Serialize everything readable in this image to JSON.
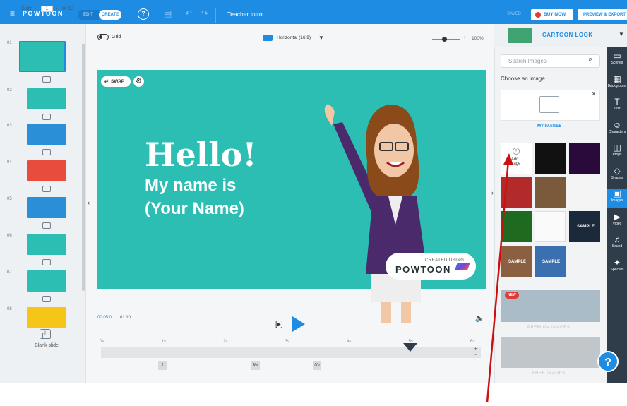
{
  "topbar": {
    "logo": "POWTOON",
    "mode_edit": "EDIT",
    "mode_create": "CREATE",
    "title": "Teacher Intro",
    "saved": "SAVED",
    "buy_now": "BUY NOW",
    "preview_export": "PREVIEW & EXPORT"
  },
  "slides": {
    "label": "Slide",
    "current": "1",
    "of_total": "of 10",
    "numbers": [
      "01",
      "02",
      "03",
      "04",
      "05",
      "06",
      "07",
      "08"
    ],
    "blank_slide": "Blank slide",
    "thumb_colors": [
      "#2cbeb3",
      "#2cbeb3",
      "#2a8fd6",
      "#e74c3c",
      "#2a8fd6",
      "#2cbeb3",
      "#2cbeb3",
      "#f5c518"
    ]
  },
  "canvas": {
    "grid_label": "Grid",
    "orientation": "Horizontal (16:9)",
    "zoom": "100%",
    "swap": "SWAP",
    "hello": "Hello!",
    "my_name_is": "My name is",
    "your_name": "(Your Name)",
    "created_using": "CREATED USING",
    "powtoon": "POWTOON"
  },
  "playback": {
    "current_time": "00:05:0",
    "total_time": "01:10",
    "ticks": [
      "0s",
      "1s",
      "2s",
      "3s",
      "4s",
      "5s",
      "6s"
    ],
    "markers": [
      "2",
      "My",
      "(Yo"
    ]
  },
  "rightpanel": {
    "look": "CARTOON LOOK",
    "search_placeholder": "Search Images",
    "choose_label": "Choose an image",
    "my_images": "MY IMAGES",
    "add_image": "Add\nimage",
    "new_badge": "NEW",
    "premium_images": "PREMIUM IMAGES",
    "free_images": "FREE IMAGES",
    "sample": "SAMPLE"
  },
  "rail": [
    {
      "icon": "scenes-icon",
      "glyph": "▭",
      "label": "Scenes"
    },
    {
      "icon": "background-icon",
      "glyph": "▦",
      "label": "Background"
    },
    {
      "icon": "text-icon",
      "glyph": "T",
      "label": "Text"
    },
    {
      "icon": "characters-icon",
      "glyph": "☺",
      "label": "Characters"
    },
    {
      "icon": "props-icon",
      "glyph": "◫",
      "label": "Props"
    },
    {
      "icon": "shapes-icon",
      "glyph": "◇",
      "label": "Shapes"
    },
    {
      "icon": "images-icon",
      "glyph": "▣",
      "label": "Images"
    },
    {
      "icon": "video-icon",
      "glyph": "▶",
      "label": "Video"
    },
    {
      "icon": "sound-icon",
      "glyph": "♫",
      "label": "Sound"
    },
    {
      "icon": "specials-icon",
      "glyph": "✦",
      "label": "Specials"
    }
  ],
  "help": "?"
}
